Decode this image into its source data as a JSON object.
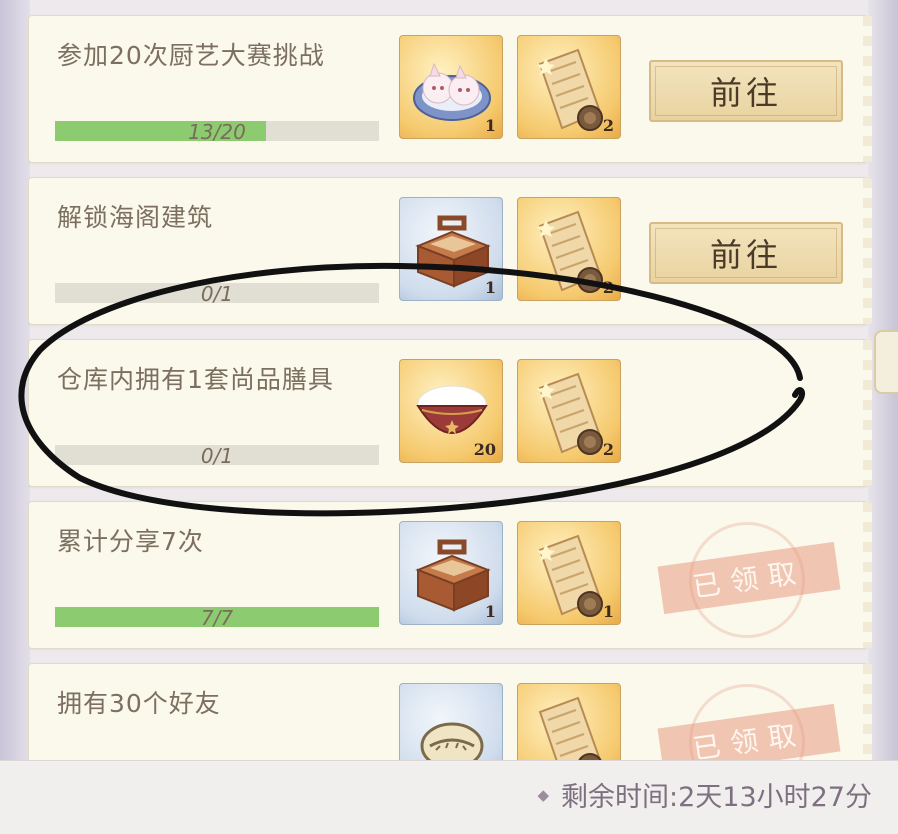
{
  "tasks": [
    {
      "title": "参加20次厨艺大赛挑战",
      "progress_text": "13/20",
      "progress": 0.65,
      "rewards": [
        {
          "icon": "dumpling-plate-icon",
          "count": "1",
          "frame": "gold"
        },
        {
          "icon": "scroll-icon",
          "count": "2",
          "frame": "gold"
        }
      ],
      "action": {
        "type": "button",
        "label": "前往"
      }
    },
    {
      "title": "解锁海阁建筑",
      "progress_text": "0/1",
      "progress": 0,
      "rewards": [
        {
          "icon": "wooden-box-icon",
          "count": "1",
          "frame": "blue"
        },
        {
          "icon": "scroll-icon",
          "count": "2",
          "frame": "gold"
        }
      ],
      "action": {
        "type": "button",
        "label": "前往"
      }
    },
    {
      "title": "仓库内拥有1套尚品膳具",
      "progress_text": "0/1",
      "progress": 0,
      "rewards": [
        {
          "icon": "rice-bowl-icon",
          "count": "20",
          "frame": "gold"
        },
        {
          "icon": "scroll-icon",
          "count": "2",
          "frame": "gold"
        }
      ],
      "action": {
        "type": "none"
      }
    },
    {
      "title": "累计分享7次",
      "progress_text": "7/7",
      "progress": 1,
      "rewards": [
        {
          "icon": "wooden-box-icon",
          "count": "1",
          "frame": "blue"
        },
        {
          "icon": "scroll-icon",
          "count": "1",
          "frame": "gold"
        }
      ],
      "action": {
        "type": "stamp",
        "label": "已领取"
      }
    },
    {
      "title": "拥有30个好友",
      "progress_text": "",
      "progress": 0,
      "rewards": [
        {
          "icon": "shell-icon",
          "count": "",
          "frame": "blue"
        },
        {
          "icon": "scroll-icon",
          "count": "",
          "frame": "gold"
        }
      ],
      "action": {
        "type": "stamp",
        "label": "已领取"
      }
    }
  ],
  "footer": {
    "remaining_time": "剩余时间:2天13小时27分"
  }
}
